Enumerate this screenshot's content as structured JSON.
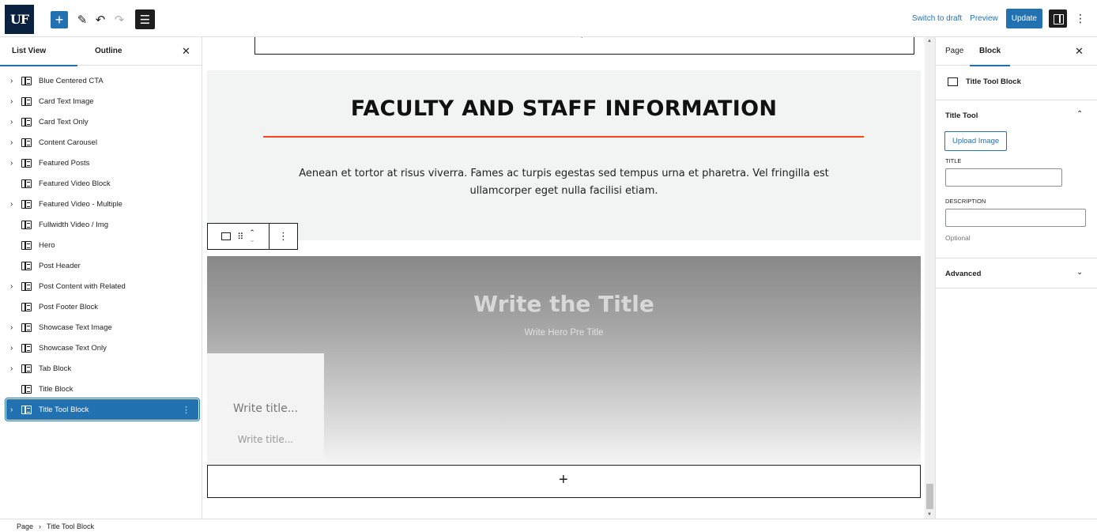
{
  "topbar": {
    "logo": "UF",
    "add_icon": "+",
    "edit_icon": "✎",
    "undo_icon": "↶",
    "redo_icon": "↷",
    "list_view_icon": "☰",
    "switch_to_draft": "Switch to draft",
    "preview": "Preview",
    "update": "Update",
    "more_icon": "⋮"
  },
  "list_panel": {
    "tab_list": "List View",
    "tab_outline": "Outline",
    "close_icon": "✕",
    "items": [
      {
        "label": "Blue Centered CTA",
        "chevron": "›"
      },
      {
        "label": "Card Text Image",
        "chevron": "›"
      },
      {
        "label": "Card Text Only",
        "chevron": "›"
      },
      {
        "label": "Content Carousel",
        "chevron": "›"
      },
      {
        "label": "Featured Posts",
        "chevron": "›"
      },
      {
        "label": "Featured Video Block",
        "chevron": ""
      },
      {
        "label": "Featured Video - Multiple",
        "chevron": "›"
      },
      {
        "label": "Fullwidth Video / Img",
        "chevron": ""
      },
      {
        "label": "Hero",
        "chevron": ""
      },
      {
        "label": "Post Header",
        "chevron": ""
      },
      {
        "label": "Post Content with Related",
        "chevron": "›"
      },
      {
        "label": "Post Footer Block",
        "chevron": ""
      },
      {
        "label": "Showcase Text Image",
        "chevron": "›"
      },
      {
        "label": "Showcase Text Only",
        "chevron": "›"
      },
      {
        "label": "Tab Block",
        "chevron": "›"
      },
      {
        "label": "Title Block",
        "chevron": ""
      },
      {
        "label": "Title Tool Block",
        "chevron": "›",
        "selected": true
      }
    ],
    "selected_more_icon": "⋮"
  },
  "canvas": {
    "top_appender": "+",
    "faculty_title": "FACULTY AND STAFF INFORMATION",
    "faculty_text": "Aenean et tortor at risus viverra. Fames ac turpis egestas sed tempus urna et pharetra. Vel fringilla est ullamcorper eget nulla facilisi etiam.",
    "block_toolbar": {
      "drag_icon": "⠿",
      "move_up": "⌃",
      "move_down": "⌄",
      "options_icon": "⋮"
    },
    "hero_title": "Write the Title",
    "hero_pre_title": "Write Hero Pre Title",
    "card_title": "Write title...",
    "card_subtitle": "Write title...",
    "bottom_appender": "+"
  },
  "settings_panel": {
    "tab_page": "Page",
    "tab_block": "Block",
    "close_icon": "✕",
    "block_name": "Title Tool Block",
    "section_title_tool": "Title Tool",
    "section_title_tool_toggle": "⌃",
    "upload_image": "Upload Image",
    "title_label": "TITLE",
    "title_value": "",
    "description_label": "DESCRIPTION",
    "description_value": "",
    "description_help": "Optional",
    "section_advanced": "Advanced",
    "section_advanced_toggle": "⌄"
  },
  "footer": {
    "crumb_page": "Page",
    "crumb_sep": "›",
    "crumb_block": "Title Tool Block"
  },
  "colors": {
    "accent": "#2271b1",
    "logo_bg": "#0a2240",
    "rule": "#fa4616"
  }
}
